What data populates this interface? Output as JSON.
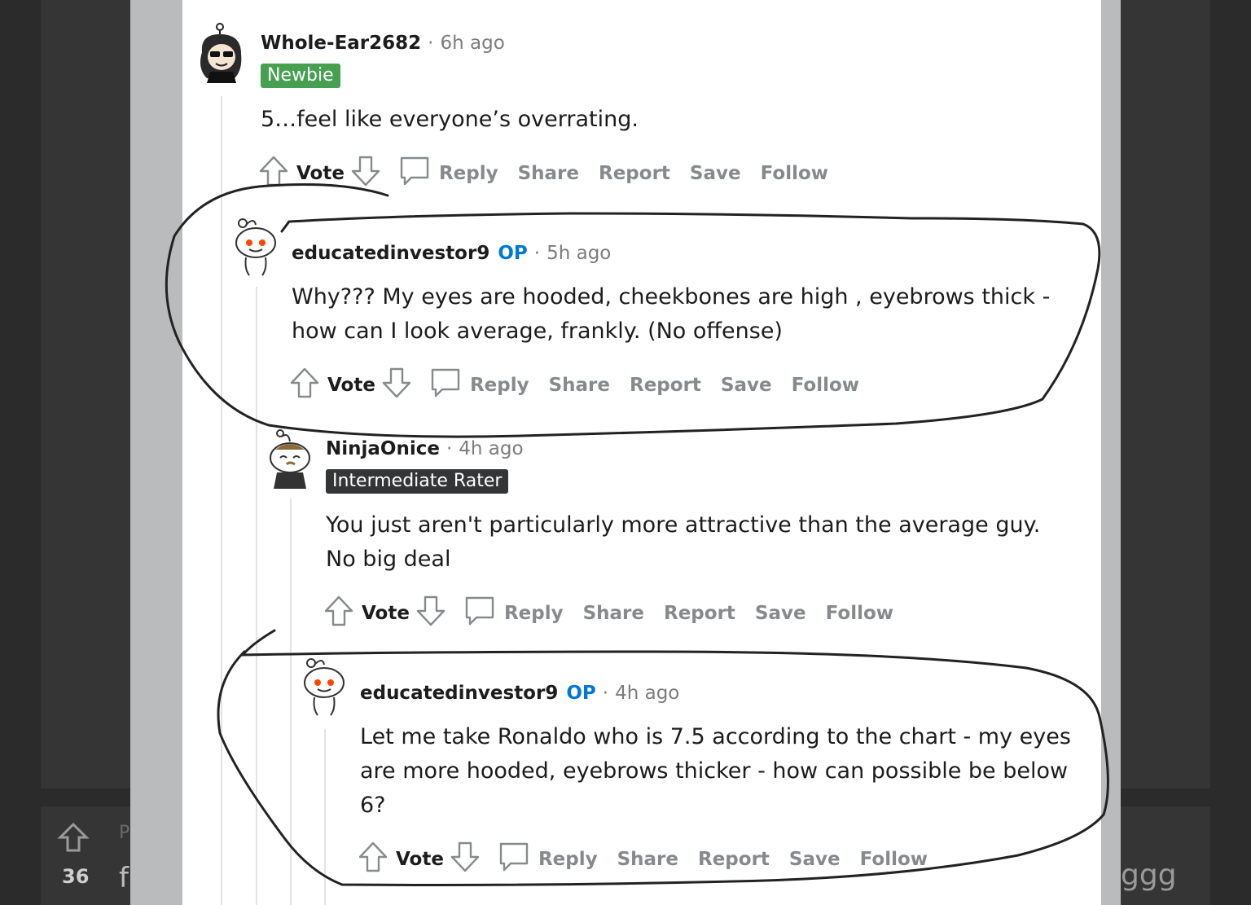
{
  "background": {
    "vote_count": "36",
    "letter": "f",
    "letter_top": "P",
    "tail_text": "ggg"
  },
  "comments": [
    {
      "author": "Whole-Ear2682",
      "time": "6h ago",
      "flair": "Newbie",
      "body": "5…feel like everyone’s overrating.",
      "actions": {
        "vote": "Vote",
        "reply": "Reply",
        "share": "Share",
        "report": "Report",
        "save": "Save",
        "follow": "Follow"
      }
    },
    {
      "author": "educatedinvestor9",
      "op_badge": "OP",
      "time": "5h ago",
      "body_lines": [
        "Why??? My eyes are hooded, cheekbones are high , eyebrows thick -",
        "how can I look average, frankly. (No offense)"
      ],
      "actions": {
        "vote": "Vote",
        "reply": "Reply",
        "share": "Share",
        "report": "Report",
        "save": "Save",
        "follow": "Follow"
      }
    },
    {
      "author": "NinjaOnice",
      "time": "4h ago",
      "flair": "Intermediate Rater",
      "body_lines": [
        "You just aren't particularly more attractive than the average guy.",
        "No big deal"
      ],
      "actions": {
        "vote": "Vote",
        "reply": "Reply",
        "share": "Share",
        "report": "Report",
        "save": "Save",
        "follow": "Follow"
      }
    },
    {
      "author": "educatedinvestor9",
      "op_badge": "OP",
      "time": "4h ago",
      "body_lines": [
        "Let me take Ronaldo who is 7.5 according to the chart - my eyes",
        "are more hooded, eyebrows thicker - how can possible be below",
        "6?"
      ],
      "actions": {
        "vote": "Vote",
        "reply": "Reply",
        "share": "Share",
        "report": "Report",
        "save": "Save",
        "follow": "Follow"
      }
    }
  ],
  "colors": {
    "op": "#0079d3",
    "newbie_flair": "#46a04f",
    "rater_flair": "#343536",
    "action_text": "#878a8c"
  }
}
